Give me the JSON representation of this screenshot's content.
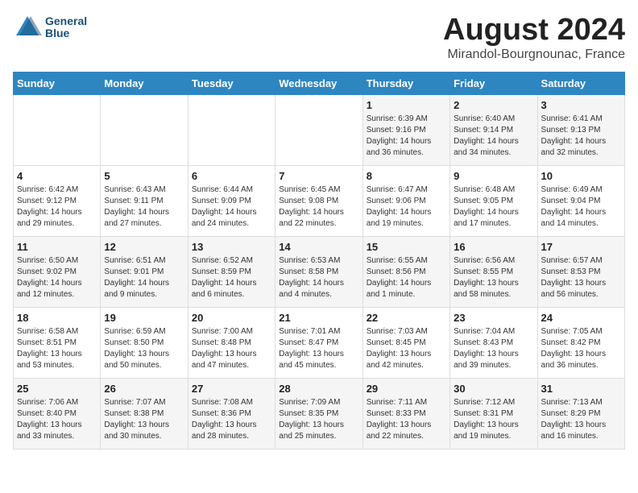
{
  "header": {
    "logo_line1": "General",
    "logo_line2": "Blue",
    "main_title": "August 2024",
    "subtitle": "Mirandol-Bourgnounac, France"
  },
  "days_of_week": [
    "Sunday",
    "Monday",
    "Tuesday",
    "Wednesday",
    "Thursday",
    "Friday",
    "Saturday"
  ],
  "weeks": [
    [
      {
        "day": "",
        "content": ""
      },
      {
        "day": "",
        "content": ""
      },
      {
        "day": "",
        "content": ""
      },
      {
        "day": "",
        "content": ""
      },
      {
        "day": "1",
        "content": "Sunrise: 6:39 AM\nSunset: 9:16 PM\nDaylight: 14 hours and 36 minutes."
      },
      {
        "day": "2",
        "content": "Sunrise: 6:40 AM\nSunset: 9:14 PM\nDaylight: 14 hours and 34 minutes."
      },
      {
        "day": "3",
        "content": "Sunrise: 6:41 AM\nSunset: 9:13 PM\nDaylight: 14 hours and 32 minutes."
      }
    ],
    [
      {
        "day": "4",
        "content": "Sunrise: 6:42 AM\nSunset: 9:12 PM\nDaylight: 14 hours and 29 minutes."
      },
      {
        "day": "5",
        "content": "Sunrise: 6:43 AM\nSunset: 9:11 PM\nDaylight: 14 hours and 27 minutes."
      },
      {
        "day": "6",
        "content": "Sunrise: 6:44 AM\nSunset: 9:09 PM\nDaylight: 14 hours and 24 minutes."
      },
      {
        "day": "7",
        "content": "Sunrise: 6:45 AM\nSunset: 9:08 PM\nDaylight: 14 hours and 22 minutes."
      },
      {
        "day": "8",
        "content": "Sunrise: 6:47 AM\nSunset: 9:06 PM\nDaylight: 14 hours and 19 minutes."
      },
      {
        "day": "9",
        "content": "Sunrise: 6:48 AM\nSunset: 9:05 PM\nDaylight: 14 hours and 17 minutes."
      },
      {
        "day": "10",
        "content": "Sunrise: 6:49 AM\nSunset: 9:04 PM\nDaylight: 14 hours and 14 minutes."
      }
    ],
    [
      {
        "day": "11",
        "content": "Sunrise: 6:50 AM\nSunset: 9:02 PM\nDaylight: 14 hours and 12 minutes."
      },
      {
        "day": "12",
        "content": "Sunrise: 6:51 AM\nSunset: 9:01 PM\nDaylight: 14 hours and 9 minutes."
      },
      {
        "day": "13",
        "content": "Sunrise: 6:52 AM\nSunset: 8:59 PM\nDaylight: 14 hours and 6 minutes."
      },
      {
        "day": "14",
        "content": "Sunrise: 6:53 AM\nSunset: 8:58 PM\nDaylight: 14 hours and 4 minutes."
      },
      {
        "day": "15",
        "content": "Sunrise: 6:55 AM\nSunset: 8:56 PM\nDaylight: 14 hours and 1 minute."
      },
      {
        "day": "16",
        "content": "Sunrise: 6:56 AM\nSunset: 8:55 PM\nDaylight: 13 hours and 58 minutes."
      },
      {
        "day": "17",
        "content": "Sunrise: 6:57 AM\nSunset: 8:53 PM\nDaylight: 13 hours and 56 minutes."
      }
    ],
    [
      {
        "day": "18",
        "content": "Sunrise: 6:58 AM\nSunset: 8:51 PM\nDaylight: 13 hours and 53 minutes."
      },
      {
        "day": "19",
        "content": "Sunrise: 6:59 AM\nSunset: 8:50 PM\nDaylight: 13 hours and 50 minutes."
      },
      {
        "day": "20",
        "content": "Sunrise: 7:00 AM\nSunset: 8:48 PM\nDaylight: 13 hours and 47 minutes."
      },
      {
        "day": "21",
        "content": "Sunrise: 7:01 AM\nSunset: 8:47 PM\nDaylight: 13 hours and 45 minutes."
      },
      {
        "day": "22",
        "content": "Sunrise: 7:03 AM\nSunset: 8:45 PM\nDaylight: 13 hours and 42 minutes."
      },
      {
        "day": "23",
        "content": "Sunrise: 7:04 AM\nSunset: 8:43 PM\nDaylight: 13 hours and 39 minutes."
      },
      {
        "day": "24",
        "content": "Sunrise: 7:05 AM\nSunset: 8:42 PM\nDaylight: 13 hours and 36 minutes."
      }
    ],
    [
      {
        "day": "25",
        "content": "Sunrise: 7:06 AM\nSunset: 8:40 PM\nDaylight: 13 hours and 33 minutes."
      },
      {
        "day": "26",
        "content": "Sunrise: 7:07 AM\nSunset: 8:38 PM\nDaylight: 13 hours and 30 minutes."
      },
      {
        "day": "27",
        "content": "Sunrise: 7:08 AM\nSunset: 8:36 PM\nDaylight: 13 hours and 28 minutes."
      },
      {
        "day": "28",
        "content": "Sunrise: 7:09 AM\nSunset: 8:35 PM\nDaylight: 13 hours and 25 minutes."
      },
      {
        "day": "29",
        "content": "Sunrise: 7:11 AM\nSunset: 8:33 PM\nDaylight: 13 hours and 22 minutes."
      },
      {
        "day": "30",
        "content": "Sunrise: 7:12 AM\nSunset: 8:31 PM\nDaylight: 13 hours and 19 minutes."
      },
      {
        "day": "31",
        "content": "Sunrise: 7:13 AM\nSunset: 8:29 PM\nDaylight: 13 hours and 16 minutes."
      }
    ]
  ]
}
